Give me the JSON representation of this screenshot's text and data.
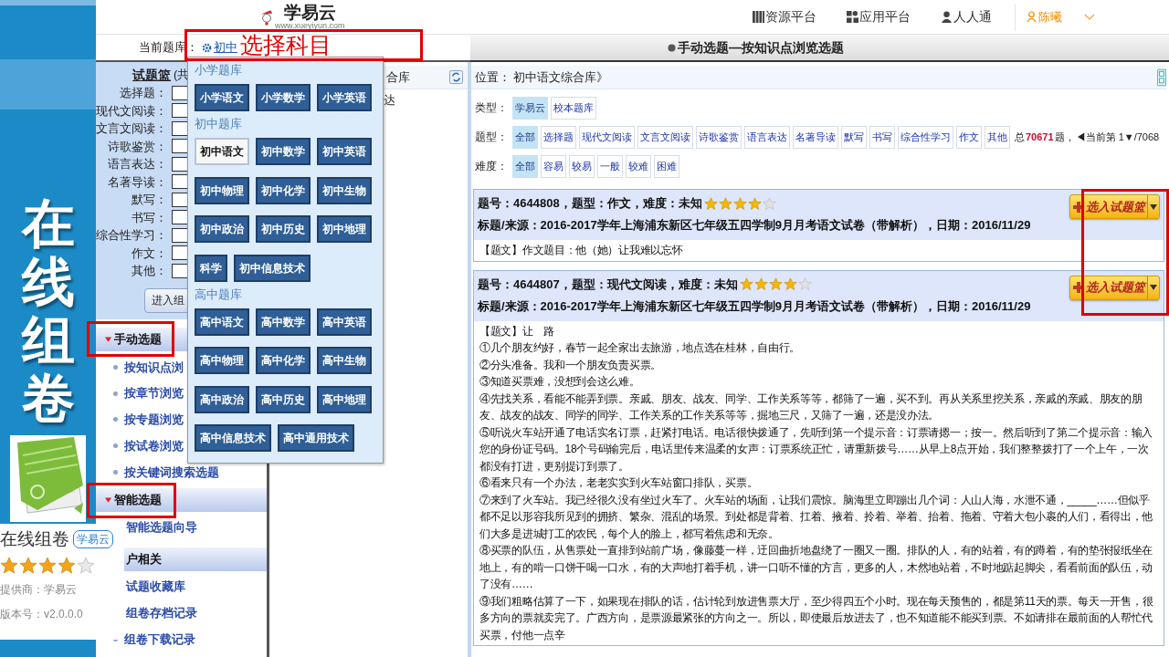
{
  "side_banner": {
    "title": "在线组卷"
  },
  "app_card": {
    "name": "在线组卷",
    "tag": "学易云",
    "stars": 4,
    "provider": "提供商：学易云",
    "version": "版本号：v2.0.0.0"
  },
  "header": {
    "logo": "学易云",
    "logo_url": "www.xueyiyun.com",
    "nav": [
      {
        "label": "资源平台",
        "kind": "grid"
      },
      {
        "label": "应用平台",
        "kind": "apps"
      },
      {
        "label": "人人通",
        "kind": "people"
      }
    ],
    "user": "陈曦"
  },
  "library_bar": {
    "label": "当前题库：",
    "current": "初中"
  },
  "page_title": "手动选题—按知识点浏览选题",
  "basket": {
    "title": "试题篮",
    "count_prefix": "(共",
    "rows": [
      "选择题：",
      "现代文阅读：",
      "文言文阅读：",
      "诗歌鉴赏：",
      "语言表达：",
      "名著导读：",
      "默写：",
      "书写：",
      "综合性学习：",
      "作文：",
      "其他："
    ],
    "button": "进入组"
  },
  "nav": [
    {
      "label": "手动选题",
      "expanded": true,
      "items": [
        {
          "label": "按知识点浏",
          "bullet": true
        },
        {
          "label": "按章节浏览",
          "bullet": true
        },
        {
          "label": "按专题浏览",
          "bullet": true
        },
        {
          "label": "按试卷浏览",
          "bullet": true
        },
        {
          "label": "按关键词搜索选题",
          "bullet": true
        }
      ]
    },
    {
      "label": "智能选题",
      "expanded": true,
      "items": [
        {
          "label": "智能选题向导",
          "bullet": false
        }
      ]
    },
    {
      "label": "户相关",
      "expanded": false,
      "items": [
        {
          "label": "试题收藏库",
          "bullet": false
        },
        {
          "label": "组卷存档记录",
          "bullet": false
        },
        {
          "label": "组卷下载记录",
          "bullet": true
        }
      ]
    }
  ],
  "tree": {
    "header": "合库",
    "items": [
      "达"
    ]
  },
  "dropdown": {
    "sections": [
      {
        "title": "小学题库",
        "options": [
          {
            "label": "小学语文",
            "selected": false
          },
          {
            "label": "小学数学",
            "selected": false
          },
          {
            "label": "小学英语",
            "selected": false
          }
        ]
      },
      {
        "title": "初中题库",
        "options": [
          {
            "label": "初中语文",
            "selected": true
          },
          {
            "label": "初中数学",
            "selected": false
          },
          {
            "label": "初中英语",
            "selected": false
          },
          {
            "label": "初中物理",
            "selected": false
          },
          {
            "label": "初中化学",
            "selected": false
          },
          {
            "label": "初中生物",
            "selected": false
          },
          {
            "label": "初中政治",
            "selected": false
          },
          {
            "label": "初中历史",
            "selected": false
          },
          {
            "label": "初中地理",
            "selected": false
          },
          {
            "label": "科学",
            "selected": false
          },
          {
            "label": "初中信息技术",
            "selected": false
          }
        ]
      },
      {
        "title": "高中题库",
        "options": [
          {
            "label": "高中语文",
            "selected": false
          },
          {
            "label": "高中数学",
            "selected": false
          },
          {
            "label": "高中英语",
            "selected": false
          },
          {
            "label": "高中物理",
            "selected": false
          },
          {
            "label": "高中化学",
            "selected": false
          },
          {
            "label": "高中生物",
            "selected": false
          },
          {
            "label": "高中政治",
            "selected": false
          },
          {
            "label": "高中历史",
            "selected": false
          },
          {
            "label": "高中地理",
            "selected": false
          },
          {
            "label": "高中信息技术",
            "selected": false
          },
          {
            "label": "高中通用技术",
            "selected": false
          }
        ]
      }
    ]
  },
  "location": {
    "label": "位置：",
    "path": "初中语文综合库》"
  },
  "filters": [
    {
      "label": "类型：",
      "options": [
        {
          "label": "学易云",
          "selected": true
        },
        {
          "label": "校本题库",
          "selected": false
        }
      ]
    },
    {
      "label": "题型：",
      "options": [
        {
          "label": "全部",
          "selected": true
        },
        {
          "label": "选择题",
          "selected": false
        },
        {
          "label": "现代文阅读",
          "selected": false
        },
        {
          "label": "文言文阅读",
          "selected": false
        },
        {
          "label": "诗歌鉴赏",
          "selected": false
        },
        {
          "label": "语言表达",
          "selected": false
        },
        {
          "label": "名著导读",
          "selected": false
        },
        {
          "label": "默写",
          "selected": false
        },
        {
          "label": "书写",
          "selected": false
        },
        {
          "label": "综合性学习",
          "selected": false
        },
        {
          "label": "作文",
          "selected": false
        },
        {
          "label": "其他",
          "selected": false
        }
      ]
    },
    {
      "label": "难度：",
      "options": [
        {
          "label": "全部",
          "selected": true
        },
        {
          "label": "容易",
          "selected": false
        },
        {
          "label": "较易",
          "selected": false
        },
        {
          "label": "一般",
          "selected": false
        },
        {
          "label": "较难",
          "selected": false
        },
        {
          "label": "困难",
          "selected": false
        }
      ]
    }
  ],
  "total": {
    "prefix": "总",
    "count": "70671",
    "suffix": "题，",
    "pager": "◀当前第 1▼/7068"
  },
  "questions": [
    {
      "meta": "题号：4644808，题型：作文，难度：未知",
      "stars": 4,
      "source": "标题/来源：2016-2017学年上海浦东新区七年级五四学制9月月考语文试卷（带解析），日期：2016/11/29",
      "button": "选入试题篮",
      "body": [
        "【题文】作文题目：他（她）让我难以忘怀"
      ]
    },
    {
      "meta": "题号：4644807，题型：现代文阅读，难度：未知",
      "stars": 4,
      "source": "标题/来源：2016-2017学年上海浦东新区七年级五四学制9月月考语文试卷（带解析），日期：2016/11/29",
      "button": "选入试题篮",
      "body": [
        "【题文】让　路",
        "①几个朋友约好，春节一起全家出去旅游，地点选在桂林，自由行。",
        "②分头准备。我和一个朋友负责买票。",
        "③知道买票难，没想到会这么难。",
        "④先找关系，看能不能弄到票。亲戚、朋友、战友、同学、工作关系等等，都筛了一遍，买不到。再从关系里挖关系，亲戚的亲戚、朋友的朋友、战友的战友、同学的同学、工作关系的工作关系等等，掘地三尺，又筛了一遍，还是没办法。",
        "⑤听说火车站开通了电话实名订票，赶紧打电话。电话很快拨通了，先听到第一个提示音：订票请摁一；按一。然后听到了第二个提示音：输入您的身份证号码。18个号码输完后，电话里传来温柔的女声：订票系统正忙，请重新拨号……从早上8点开始，我们整整拨打了一个上午，一次都没有打进，更别提订到票了。",
        "⑥看来只有一个办法，老老实实到火车站窗口排队，买票。",
        "⑦来到了火车站。我已经很久没有坐过火车了。火车站的场面，让我们震惊。脑海里立即蹦出几个词：人山人海，水泄不通，_____……但似乎都不足以形容我所见到的拥挤、繁杂、混乱的场景。到处都是背着、扛着、掖着、拎着、举着、抬着、拖着、守着大包小裹的人们，看得出，他们大多是进城打工的农民，每个人的脸上，都写着焦虑和无奈。",
        "⑧买票的队伍，从售票处一直排到站前广场，像藤蔓一样，迂回曲折地盘绕了一圈又一圈。排队的人，有的站着，有的蹲着，有的垫张报纸坐在地上，有的啃一口饼干喝一口水，有的大声地打着手机，讲一口听不懂的方言，更多的人，木然地站着，不时地踮起脚尖，看看前面的队伍，动了没有……",
        "⑨我们粗略估算了一下，如果现在排队的话，估计轮到放进售票大厅，至少得四五个小时。现在每天预售的，都是第11天的票。每天一开售，很多方向的票就卖完了。广西方向，是票源最紧张的方向之一。所以，即使最后放进去了，也不知道能不能买到票。不如请排在最前面的人帮忙代买票，付他一点辛"
      ]
    }
  ],
  "annotations": [
    {
      "kind": "labeled",
      "label": "选择科目"
    },
    {
      "kind": "box"
    },
    {
      "kind": "box"
    },
    {
      "kind": "box"
    }
  ]
}
